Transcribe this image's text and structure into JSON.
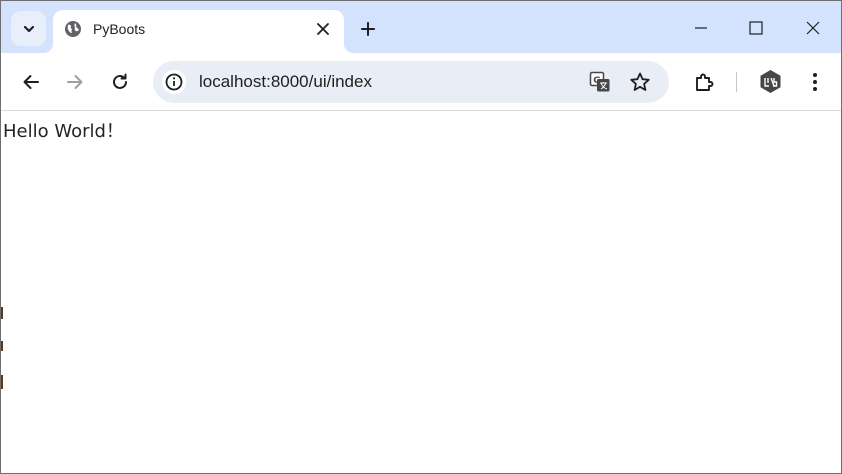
{
  "browser": {
    "tab": {
      "title": "PyBoots",
      "favicon": "globe-icon"
    },
    "address_bar": {
      "url": "localhost:8000/ui/index"
    },
    "colors": {
      "tabstrip": "#d3e3fd",
      "omnibox": "#e9eef6",
      "icon": "#474747"
    }
  },
  "page": {
    "heading": "Hello World！"
  }
}
